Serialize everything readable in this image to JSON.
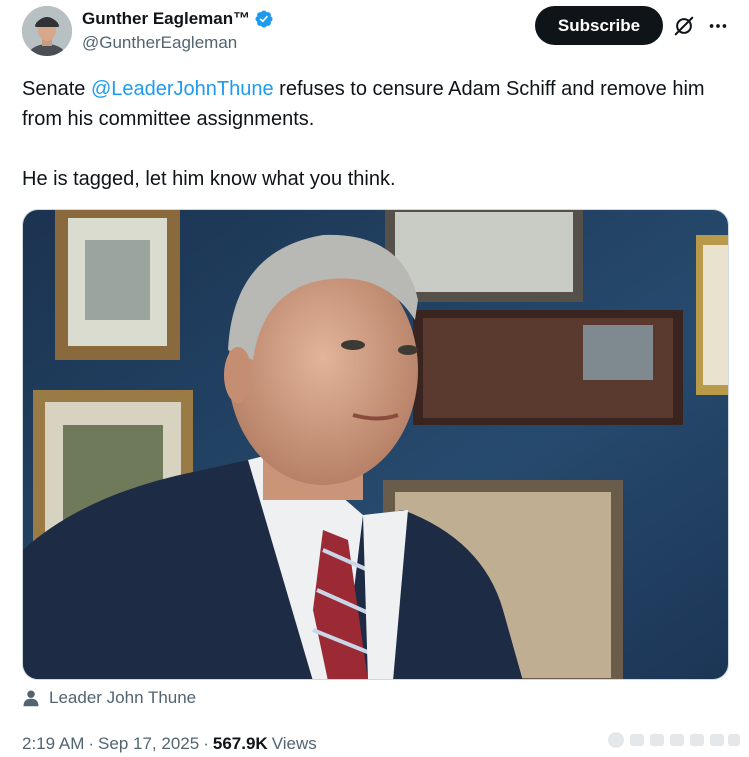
{
  "author": {
    "display_name": "Gunther Eagleman™",
    "handle": "@GuntherEagleman",
    "verified": true,
    "verified_color": "#1d9bf0"
  },
  "actions": {
    "subscribe_label": "Subscribe",
    "grok_icon": "grok-icon",
    "more_icon": "more-icon"
  },
  "tweet": {
    "text_before_mention": "Senate ",
    "mention": "@LeaderJohnThune",
    "text_after_mention": " refuses to censure Adam Schiff and remove him from his committee assignments.",
    "second_paragraph": "He is tagged,  let him know what you think."
  },
  "media": {
    "tagged_person": "Leader John Thune",
    "tag_icon": "person-icon"
  },
  "meta": {
    "time": "2:19 AM",
    "date": "Sep 17, 2025",
    "views_count": "567.9K",
    "views_label": "Views"
  },
  "colors": {
    "link": "#1d9bf0",
    "secondary_text": "#536471",
    "primary_text": "#0f1419",
    "button_bg": "#0f1419"
  }
}
